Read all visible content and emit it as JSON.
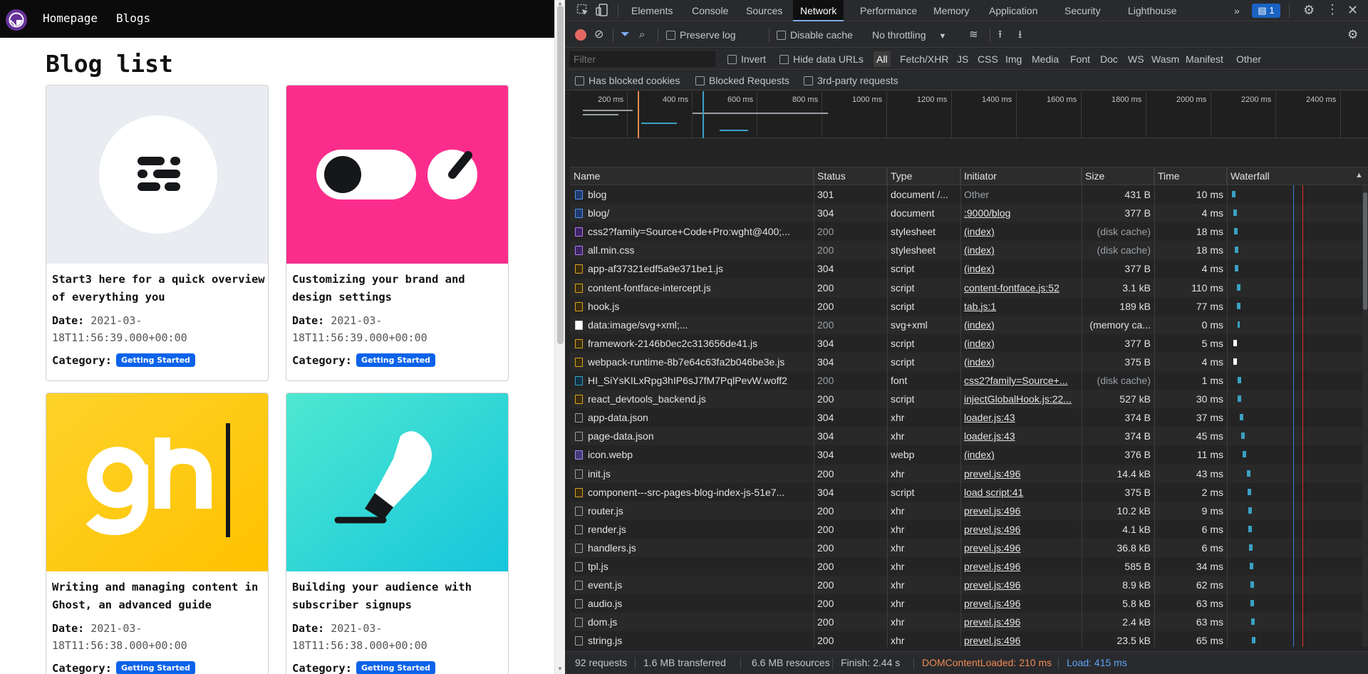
{
  "site": {
    "nav": {
      "home": "Homepage",
      "blogs": "Blogs"
    },
    "page_title": "Blog list",
    "posts": [
      {
        "title": "Start3 here for a quick overview of everything you",
        "date_label": "Date:",
        "date": "2021-03-18T11:56:39.000+00:00",
        "category_label": "Category:",
        "category": "Getting Started",
        "image_bg": "#e9ecf0"
      },
      {
        "title": "Customizing your brand and design settings",
        "date_label": "Date:",
        "date": "2021-03-18T11:56:39.000+00:00",
        "category_label": "Category:",
        "category": "Getting Started",
        "image_bg": "#fb2d8c"
      },
      {
        "title": "Writing and managing content in Ghost, an advanced guide",
        "date_label": "Date:",
        "date": "2021-03-18T11:56:38.000+00:00",
        "category_label": "Category:",
        "category": "Getting Started",
        "image_bg": "#fdd22a"
      },
      {
        "title": "Building your audience with subscriber signups",
        "date_label": "Date:",
        "date": "2021-03-18T11:56:38.000+00:00",
        "category_label": "Category:",
        "category": "Getting Started",
        "image_bg": "#2fd9d4"
      }
    ]
  },
  "devtools": {
    "tabs": [
      "Elements",
      "Console",
      "Sources",
      "Network",
      "Performance",
      "Memory",
      "Application",
      "Security",
      "Lighthouse"
    ],
    "active_tab": "Network",
    "more_tabs": "»",
    "issues_count": "1",
    "toolbar": {
      "preserve_log": "Preserve log",
      "disable_cache": "Disable cache",
      "throttling": "No throttling"
    },
    "filter": {
      "placeholder": "Filter",
      "invert": "Invert",
      "hide_data_urls": "Hide data URLs",
      "types": [
        "All",
        "Fetch/XHR",
        "JS",
        "CSS",
        "Img",
        "Media",
        "Font",
        "Doc",
        "WS",
        "Wasm",
        "Manifest",
        "Other"
      ],
      "has_blocked_cookies": "Has blocked cookies",
      "blocked_requests": "Blocked Requests",
      "third_party": "3rd-party requests"
    },
    "overview_ticks": [
      "200 ms",
      "400 ms",
      "600 ms",
      "800 ms",
      "1000 ms",
      "1200 ms",
      "1400 ms",
      "1600 ms",
      "1800 ms",
      "2000 ms",
      "2200 ms",
      "2400 ms"
    ],
    "columns": [
      "Name",
      "Status",
      "Type",
      "Initiator",
      "Size",
      "Time",
      "Waterfall"
    ],
    "requests": [
      {
        "name": "blog",
        "status": "301",
        "type": "document /...",
        "initiator": "Other",
        "size": "431 B",
        "time": "10 ms",
        "icon": "doc"
      },
      {
        "name": "blog/",
        "status": "304",
        "type": "document",
        "initiator": ":9000/blog",
        "size": "377 B",
        "time": "4 ms",
        "icon": "doc"
      },
      {
        "name": "css2?family=Source+Code+Pro:wght@400;...",
        "status": "200",
        "type": "stylesheet",
        "initiator": "(index)",
        "size": "(disk cache)",
        "time": "18 ms",
        "icon": "css"
      },
      {
        "name": "all.min.css",
        "status": "200",
        "type": "stylesheet",
        "initiator": "(index)",
        "size": "(disk cache)",
        "time": "18 ms",
        "icon": "css"
      },
      {
        "name": "app-af37321edf5a9e371be1.js",
        "status": "304",
        "type": "script",
        "initiator": "(index)",
        "size": "377 B",
        "time": "4 ms",
        "icon": "js"
      },
      {
        "name": "content-fontface-intercept.js",
        "status": "200",
        "type": "script",
        "initiator": "content-fontface.js:52",
        "size": "3.1 kB",
        "time": "110 ms",
        "icon": "js"
      },
      {
        "name": "hook.js",
        "status": "200",
        "type": "script",
        "initiator": "tab.js:1",
        "size": "189 kB",
        "time": "77 ms",
        "icon": "js"
      },
      {
        "name": "data:image/svg+xml;...",
        "status": "200",
        "type": "svg+xml",
        "initiator": "(index)",
        "size": "(memory ca...",
        "time": "0 ms",
        "icon": "img"
      },
      {
        "name": "framework-2146b0ec2c313656de41.js",
        "status": "304",
        "type": "script",
        "initiator": "(index)",
        "size": "377 B",
        "time": "5 ms",
        "icon": "js"
      },
      {
        "name": "webpack-runtime-8b7e64c63fa2b046be3e.js",
        "status": "304",
        "type": "script",
        "initiator": "(index)",
        "size": "375 B",
        "time": "4 ms",
        "icon": "js"
      },
      {
        "name": "HI_SiYsKILxRpg3hIP6sJ7fM7PqlPevW.woff2",
        "status": "200",
        "type": "font",
        "initiator": "css2?family=Source+...",
        "size": "(disk cache)",
        "time": "1 ms",
        "icon": "font"
      },
      {
        "name": "react_devtools_backend.js",
        "status": "200",
        "type": "script",
        "initiator": "injectGlobalHook.js:22...",
        "size": "527 kB",
        "time": "30 ms",
        "icon": "js"
      },
      {
        "name": "app-data.json",
        "status": "304",
        "type": "xhr",
        "initiator": "loader.js:43",
        "size": "374 B",
        "time": "37 ms",
        "icon": "xhr"
      },
      {
        "name": "page-data.json",
        "status": "304",
        "type": "xhr",
        "initiator": "loader.js:43",
        "size": "374 B",
        "time": "45 ms",
        "icon": "xhr"
      },
      {
        "name": "icon.webp",
        "status": "304",
        "type": "webp",
        "initiator": "(index)",
        "size": "376 B",
        "time": "11 ms",
        "icon": "webp"
      },
      {
        "name": "init.js",
        "status": "200",
        "type": "xhr",
        "initiator": "prevel.js:496",
        "size": "14.4 kB",
        "time": "43 ms",
        "icon": "xhr"
      },
      {
        "name": "component---src-pages-blog-index-js-51e7...",
        "status": "304",
        "type": "script",
        "initiator": "load script:41",
        "size": "375 B",
        "time": "2 ms",
        "icon": "js"
      },
      {
        "name": "router.js",
        "status": "200",
        "type": "xhr",
        "initiator": "prevel.js:496",
        "size": "10.2 kB",
        "time": "9 ms",
        "icon": "xhr"
      },
      {
        "name": "render.js",
        "status": "200",
        "type": "xhr",
        "initiator": "prevel.js:496",
        "size": "4.1 kB",
        "time": "6 ms",
        "icon": "xhr"
      },
      {
        "name": "handlers.js",
        "status": "200",
        "type": "xhr",
        "initiator": "prevel.js:496",
        "size": "36.8 kB",
        "time": "6 ms",
        "icon": "xhr"
      },
      {
        "name": "tpl.js",
        "status": "200",
        "type": "xhr",
        "initiator": "prevel.js:496",
        "size": "585 B",
        "time": "34 ms",
        "icon": "xhr"
      },
      {
        "name": "event.js",
        "status": "200",
        "type": "xhr",
        "initiator": "prevel.js:496",
        "size": "8.9 kB",
        "time": "62 ms",
        "icon": "xhr"
      },
      {
        "name": "audio.js",
        "status": "200",
        "type": "xhr",
        "initiator": "prevel.js:496",
        "size": "5.8 kB",
        "time": "63 ms",
        "icon": "xhr"
      },
      {
        "name": "dom.js",
        "status": "200",
        "type": "xhr",
        "initiator": "prevel.js:496",
        "size": "2.4 kB",
        "time": "63 ms",
        "icon": "xhr"
      },
      {
        "name": "string.js",
        "status": "200",
        "type": "xhr",
        "initiator": "prevel.js:496",
        "size": "23.5 kB",
        "time": "65 ms",
        "icon": "xhr"
      }
    ],
    "status_bar": {
      "requests": "92 requests",
      "transferred": "1.6 MB transferred",
      "resources": "6.6 MB resources",
      "finish": "Finish: 2.44 s",
      "dom_content_loaded": "DOMContentLoaded: 210 ms",
      "load": "Load: 415 ms"
    },
    "colors": {
      "dcl": "#f28b54",
      "load": "#60a5fa",
      "accent": "#7cacf8"
    }
  }
}
